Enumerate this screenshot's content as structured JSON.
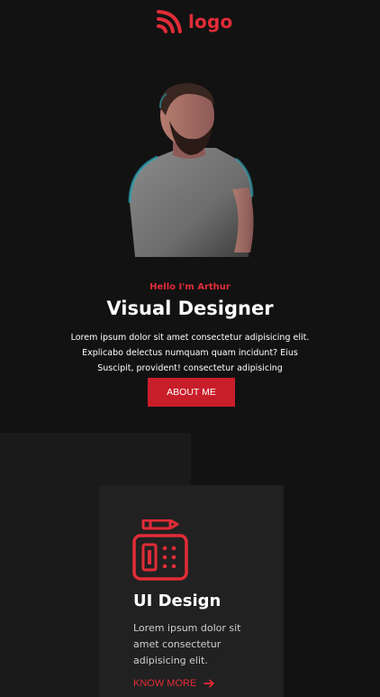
{
  "header": {
    "logo_text": "logo",
    "logo_icon": "wifi-signal-icon"
  },
  "hero": {
    "kicker": "Hello I'm Arthur",
    "title": "Visual Designer",
    "description_lines": [
      "Lorem ipsum dolor sit amet consectetur adipisicing elit.",
      "Explicabo delectus numquam quam incidunt? Eius",
      "Suscipit, provident! consectetur adipisicing"
    ],
    "button_label": "ABOUT ME"
  },
  "services": {
    "cards": [
      {
        "icon": "ui-design-icon",
        "title": "UI Design",
        "description_lines": [
          "Lorem ipsum dolor sit",
          "amet consectetur",
          "adipisicing elit."
        ],
        "link_label": "KNOW MORE",
        "link_icon": "arrow-right-icon"
      }
    ]
  },
  "colors": {
    "background": "#121212",
    "accent": "#e12c37",
    "button": "#c81e2a",
    "card": "#212121",
    "section_panel": "#1a1a1a"
  }
}
